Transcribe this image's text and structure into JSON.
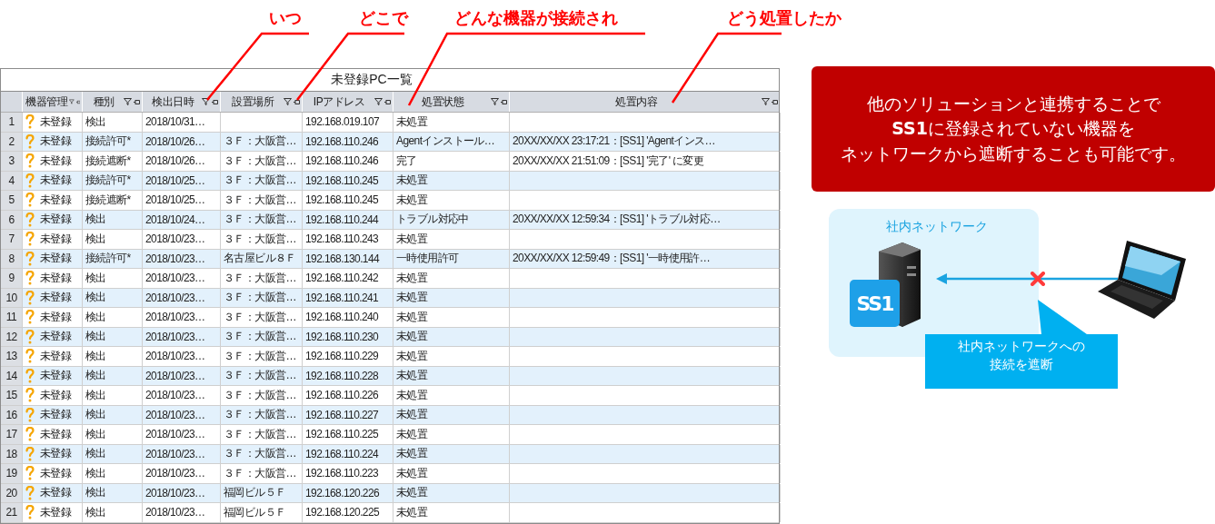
{
  "annotations": [
    {
      "label": "いつ"
    },
    {
      "label": "どこで"
    },
    {
      "label": "どんな機器が接続され"
    },
    {
      "label": "どう処置したか"
    }
  ],
  "table": {
    "title": "未登録PC一覧",
    "columns": [
      "機器管理",
      "種別",
      "検出日時",
      "設置場所",
      "IPアドレス",
      "処置状態",
      "処置内容"
    ],
    "rows": [
      {
        "number": "1",
        "status": "未登録",
        "type": "検出",
        "detected": "2018/10/31…",
        "ip": "192.168.019.107",
        "state": "未処置"
      },
      {
        "number": "2",
        "status": "未登録",
        "type": "接続許可*",
        "detected": "2018/10/26…",
        "location": "３Ｆ：大阪営…",
        "ip": "192.168.110.246",
        "state": "Agentインストール…",
        "action": "20XX/XX/XX  23:17:21：[SS1]  'Agentインス…"
      },
      {
        "number": "3",
        "status": "未登録",
        "type": "接続遮断*",
        "detected": "2018/10/26…",
        "location": "３Ｆ：大阪営…",
        "ip": "192.168.110.246",
        "state": "完了",
        "action": "20XX/XX/XX  21:51:09：[SS1]  '完了' に変更"
      },
      {
        "number": "4",
        "status": "未登録",
        "type": "接続許可*",
        "detected": "2018/10/25…",
        "location": "３Ｆ：大阪営…",
        "ip": "192.168.110.245",
        "state": "未処置"
      },
      {
        "number": "5",
        "status": "未登録",
        "type": "接続遮断*",
        "detected": "2018/10/25…",
        "location": "３Ｆ：大阪営…",
        "ip": "192.168.110.245",
        "state": "未処置"
      },
      {
        "number": "6",
        "status": "未登録",
        "type": "検出",
        "detected": "2018/10/24…",
        "location": "３Ｆ：大阪営…",
        "ip": "192.168.110.244",
        "state": "トラブル対応中",
        "action": "20XX/XX/XX  12:59:34：[SS1]  'トラブル対応…"
      },
      {
        "number": "7",
        "status": "未登録",
        "type": "検出",
        "detected": "2018/10/23…",
        "location": "３Ｆ：大阪営…",
        "ip": "192.168.110.243",
        "state": "未処置"
      },
      {
        "number": "8",
        "status": "未登録",
        "type": "接続許可*",
        "detected": "2018/10/23…",
        "location": "名古屋ビル８Ｆ",
        "ip": "192.168.130.144",
        "state": "一時使用許可",
        "action": "20XX/XX/XX  12:59:49：[SS1]  '一時使用許…"
      },
      {
        "number": "9",
        "status": "未登録",
        "type": "検出",
        "detected": "2018/10/23…",
        "location": "３Ｆ：大阪営…",
        "ip": "192.168.110.242",
        "state": "未処置"
      },
      {
        "number": "10",
        "status": "未登録",
        "type": "検出",
        "detected": "2018/10/23…",
        "location": "３Ｆ：大阪営…",
        "ip": "192.168.110.241",
        "state": "未処置"
      },
      {
        "number": "11",
        "status": "未登録",
        "type": "検出",
        "detected": "2018/10/23…",
        "location": "３Ｆ：大阪営…",
        "ip": "192.168.110.240",
        "state": "未処置"
      },
      {
        "number": "12",
        "status": "未登録",
        "type": "検出",
        "detected": "2018/10/23…",
        "location": "３Ｆ：大阪営…",
        "ip": "192.168.110.230",
        "state": "未処置"
      },
      {
        "number": "13",
        "status": "未登録",
        "type": "検出",
        "detected": "2018/10/23…",
        "location": "３Ｆ：大阪営…",
        "ip": "192.168.110.229",
        "state": "未処置"
      },
      {
        "number": "14",
        "status": "未登録",
        "type": "検出",
        "detected": "2018/10/23…",
        "location": "３Ｆ：大阪営…",
        "ip": "192.168.110.228",
        "state": "未処置"
      },
      {
        "number": "15",
        "status": "未登録",
        "type": "検出",
        "detected": "2018/10/23…",
        "location": "３Ｆ：大阪営…",
        "ip": "192.168.110.226",
        "state": "未処置"
      },
      {
        "number": "16",
        "status": "未登録",
        "type": "検出",
        "detected": "2018/10/23…",
        "location": "３Ｆ：大阪営…",
        "ip": "192.168.110.227",
        "state": "未処置"
      },
      {
        "number": "17",
        "status": "未登録",
        "type": "検出",
        "detected": "2018/10/23…",
        "location": "３Ｆ：大阪営…",
        "ip": "192.168.110.225",
        "state": "未処置"
      },
      {
        "number": "18",
        "status": "未登録",
        "type": "検出",
        "detected": "2018/10/23…",
        "location": "３Ｆ：大阪営…",
        "ip": "192.168.110.224",
        "state": "未処置"
      },
      {
        "number": "19",
        "status": "未登録",
        "type": "検出",
        "detected": "2018/10/23…",
        "location": "３Ｆ：大阪営…",
        "ip": "192.168.110.223",
        "state": "未処置"
      },
      {
        "number": "20",
        "status": "未登録",
        "type": "検出",
        "detected": "2018/10/23…",
        "location": "福岡ビル５Ｆ",
        "ip": "192.168.120.226",
        "state": "未処置"
      },
      {
        "number": "21",
        "status": "未登録",
        "type": "検出",
        "detected": "2018/10/23…",
        "location": "福岡ビル５Ｆ",
        "ip": "192.168.120.225",
        "state": "未処置"
      }
    ]
  },
  "notice": {
    "lines": [
      "他のソリューションと連携することで",
      "**SS1**に登録されていない機器を",
      "ネットワークから遮断することも可能です。"
    ]
  },
  "diagram": {
    "network_label": "社内ネットワーク",
    "logo": "SS1",
    "callout": [
      "社内ネットワークへの",
      "接続を遮断"
    ]
  }
}
